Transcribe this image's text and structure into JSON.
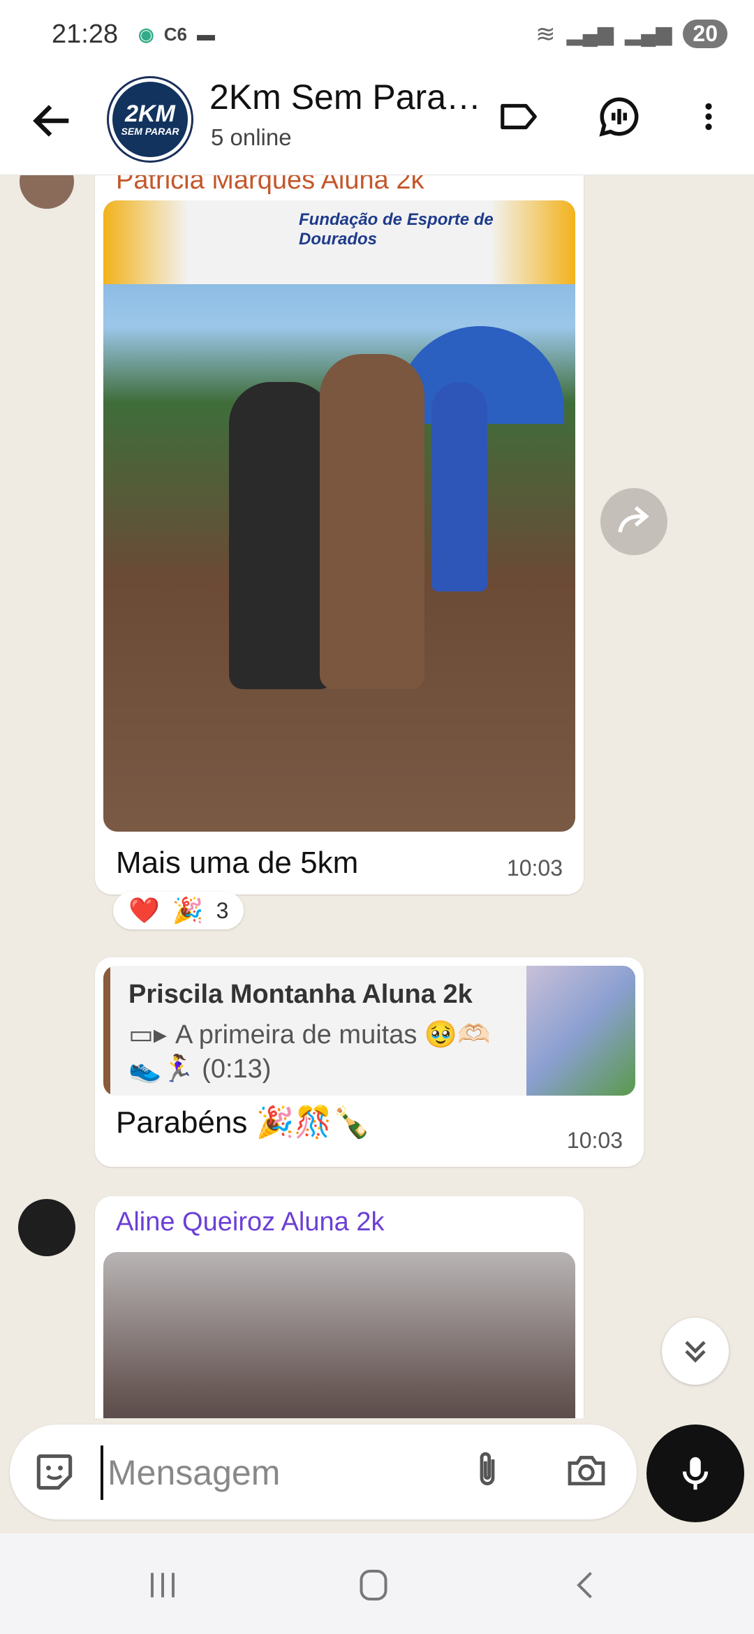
{
  "status": {
    "time": "21:28",
    "carrier_icon": "C6",
    "battery": "20"
  },
  "header": {
    "title": "2Km Sem Para…",
    "subtitle": "5 online",
    "avatar_line1": "2KM",
    "avatar_line2": "SEM PARAR"
  },
  "messages": [
    {
      "sender": "Patricia Marques Aluna 2k",
      "sender_color": "#c4572b",
      "banner": "Fundação de Esporte de Dourados",
      "text": "Mais uma de 5km",
      "time": "10:03",
      "reactions": [
        "❤️",
        "🎉"
      ],
      "reaction_count": "3"
    },
    {
      "quote_sender": "Priscila Montanha Aluna 2k",
      "quote_text": "A primeira de muitas 🥹🫶🏻",
      "quote_text2": "👟🏃‍♀️ (0:13)",
      "text": "Parabéns 🎉🎊🍾",
      "time": "10:03"
    },
    {
      "sender": "Aline Queiroz Aluna 2k",
      "sender_color": "#6b3fd6"
    }
  ],
  "composer": {
    "placeholder": "Mensagem"
  },
  "colors": {
    "accent": "#111111",
    "chat_bg": "#efeae2",
    "quote_bar": "#8a5a3b"
  }
}
